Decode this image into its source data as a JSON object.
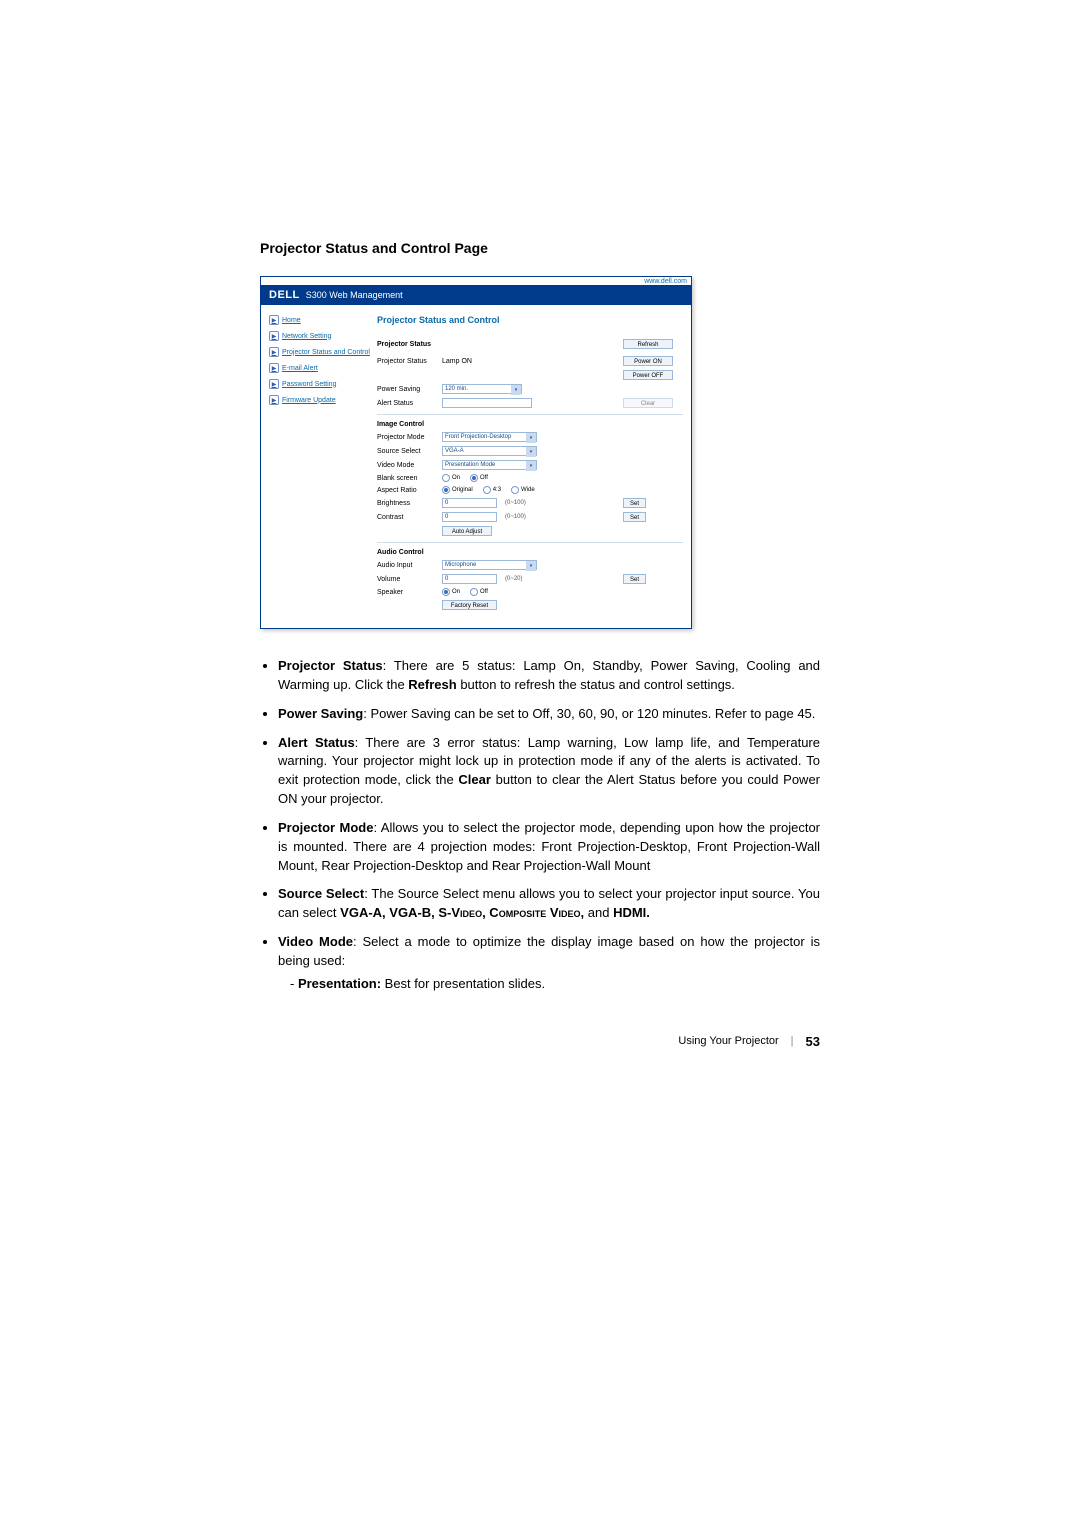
{
  "heading": "Projector Status and Control Page",
  "topLink": "www.dell.com",
  "banner": {
    "logo": "DELL",
    "product": "S300 Web Management"
  },
  "sidebar": {
    "items": [
      {
        "label": "Home"
      },
      {
        "label": "Network Setting"
      },
      {
        "label": "Projector Status and Control"
      },
      {
        "label": "E-mail Alert"
      },
      {
        "label": "Password Setting"
      },
      {
        "label": "Firmware Update"
      }
    ]
  },
  "panel": {
    "title": "Projector Status and Control",
    "status": {
      "header": "Projector Status",
      "projector_status_label": "Projector Status",
      "projector_status_value": "Lamp ON",
      "power_saving_label": "Power Saving",
      "power_saving_value": "120 min.",
      "alert_status_label": "Alert Status",
      "alert_status_value": "",
      "refresh": "Refresh",
      "power_on": "Power ON",
      "power_off": "Power OFF",
      "clear": "Clear"
    },
    "image": {
      "header": "Image Control",
      "projector_mode_label": "Projector Mode",
      "projector_mode_value": "Front Projection-Desktop",
      "source_select_label": "Source Select",
      "source_select_value": "VGA-A",
      "video_mode_label": "Video Mode",
      "video_mode_value": "Presentation Mode",
      "blank_screen_label": "Blank screen",
      "blank_on": "On",
      "blank_off": "Off",
      "aspect_ratio_label": "Aspect Ratio",
      "aspect_original": "Original",
      "aspect_43": "4:3",
      "aspect_wide": "Wide",
      "brightness_label": "Brightness",
      "brightness_value": "0",
      "brightness_range": "(0~100)",
      "contrast_label": "Contrast",
      "contrast_value": "0",
      "contrast_range": "(0~100)",
      "set": "Set",
      "auto_adjust": "Auto Adjust"
    },
    "audio": {
      "header": "Audio Control",
      "audio_input_label": "Audio Input",
      "audio_input_value": "Microphone",
      "volume_label": "Volume",
      "volume_value": "0",
      "volume_range": "(0~20)",
      "speaker_label": "Speaker",
      "speaker_on": "On",
      "speaker_off": "Off",
      "set": "Set",
      "factory_reset": "Factory Reset"
    }
  },
  "bullets": {
    "b1_head": "Projector Status",
    "b1_body": ": There are 5 status: Lamp On, Standby, Power Saving, Cooling and Warming up. Click the ",
    "b1_bold": "Refresh",
    "b1_rest": " button to refresh the status and control settings.",
    "b2_head": "Power Saving",
    "b2_body": ": Power Saving can be set to Off, 30, 60, 90, or 120 minutes. Refer to page 45.",
    "b3_head": "Alert Status",
    "b3_body": ": There are 3 error status: Lamp warning, Low lamp life, and Temperature warning. Your projector might lock up in protection mode if any of the alerts is activated. To exit protection mode, click the ",
    "b3_bold": "Clear",
    "b3_rest": " button to clear the Alert Status before you could Power ON your projector.",
    "b4_head": "Projector Mode",
    "b4_body": ": Allows you to select the projector mode, depending upon how the projector is mounted. There are 4 projection modes: Front Projection-Desktop, Front Projection-Wall Mount, Rear Projection-Desktop and Rear Projection-Wall Mount",
    "b5_head": "Source Select",
    "b5_body": ": The Source Select menu allows you to select your projector input source. You can select ",
    "b5_bold1": "VGA-A, VGA-B, S-",
    "b5_sc1": "Video",
    "b5_bold2": ", C",
    "b5_sc2": "omposite",
    "b5_bold3": " V",
    "b5_sc3": "ideo",
    "b5_bold4": ",",
    "b5_and": " and ",
    "b5_hdmi": "HDMI.",
    "b6_head": "Video Mode",
    "b6_body": ": Select a mode to optimize the display image based on how the projector is being used:",
    "b6_sub_dash": "- ",
    "b6_sub_bold": "Presentation:",
    "b6_sub_rest": " Best for presentation slides."
  },
  "footer": {
    "section": "Using Your Projector",
    "page": "53"
  }
}
